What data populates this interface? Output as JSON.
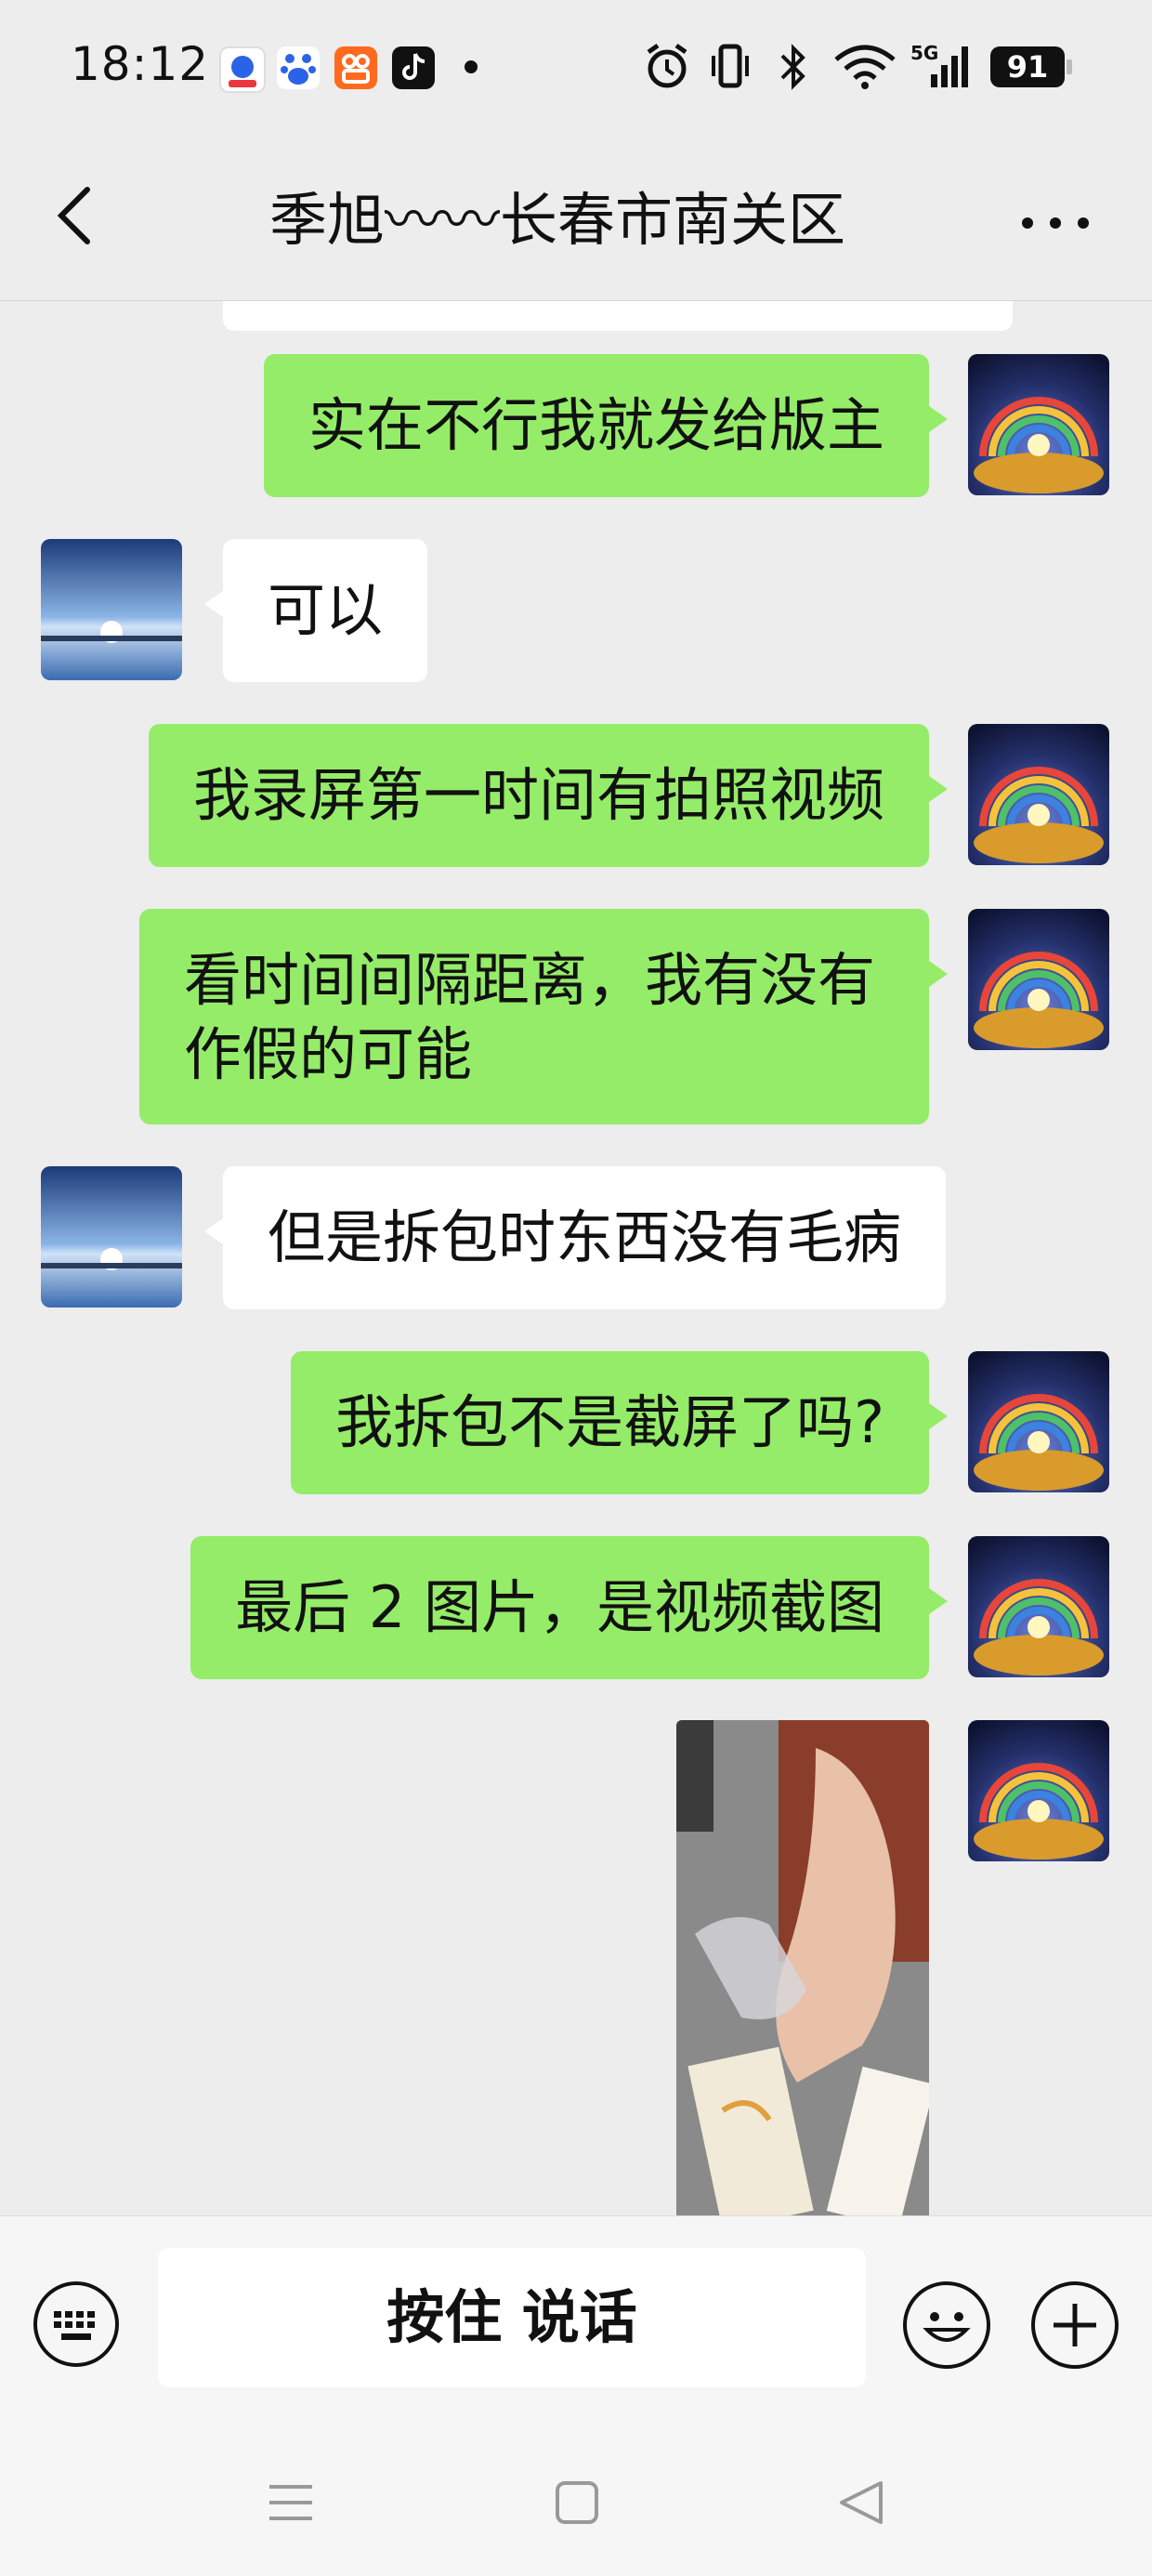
{
  "status_bar": {
    "time": "18:12",
    "app_icons": [
      "baidu-map-icon",
      "baidu-icon",
      "kuaishou-icon",
      "tiktok-icon"
    ],
    "network": "5G",
    "battery": "91"
  },
  "header": {
    "title": "季旭〰〰长春市南关区",
    "back_icon": "chevron-left-icon",
    "more_icon": "more-icon"
  },
  "messages": [
    {
      "from": "me",
      "type": "text",
      "text": "实在不行我就发给版主"
    },
    {
      "from": "them",
      "type": "text",
      "text": "可以"
    },
    {
      "from": "me",
      "type": "text",
      "text": "我录屏第一时间有拍照视频"
    },
    {
      "from": "me",
      "type": "text",
      "lines": [
        "看时间间隔距离，我有没有",
        "作假的可能"
      ]
    },
    {
      "from": "them",
      "type": "text",
      "text": "但是拆包时东西没有毛病"
    },
    {
      "from": "me",
      "type": "text",
      "text": "我拆包不是截屏了吗?"
    },
    {
      "from": "me",
      "type": "text",
      "text": "最后 2 图片，是视频截图"
    },
    {
      "from": "me",
      "type": "image",
      "text": ""
    }
  ],
  "input_bar": {
    "hold_to_talk_label": "按住 说话",
    "keyboard_icon": "keyboard-icon",
    "emoji_icon": "emoji-icon",
    "plus_icon": "plus-icon"
  },
  "nav_bar": {
    "icons": [
      "menu-icon",
      "home-icon",
      "back-triangle-icon"
    ]
  },
  "colors": {
    "my_bubble": "#95ec69",
    "their_bubble": "#ffffff",
    "background": "#ededed"
  }
}
